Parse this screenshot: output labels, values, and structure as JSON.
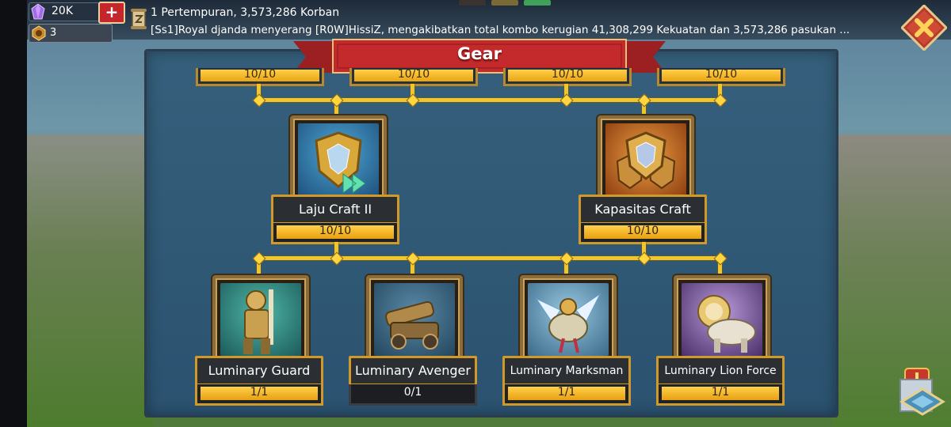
{
  "resources": {
    "gems": "20K",
    "tokens": "3"
  },
  "news": {
    "headline": "1 Pertempuran, 3,573,286 Korban",
    "detail": "[Ss1]Royal djanda menyerang [R0W]HissiZ, mengakibatkan total kombo kerugian 41,308,299 Kekuatan dan 3,573,286 pasukan ..."
  },
  "page_tabs": [
    {
      "color": "#3a3430"
    },
    {
      "color": "#7a6a35"
    },
    {
      "color": "#3fa15a"
    }
  ],
  "title": "Gear",
  "top_row": [
    {
      "progress": "10/10",
      "fill": 1.0
    },
    {
      "progress": "10/10",
      "fill": 1.0
    },
    {
      "progress": "10/10",
      "fill": 1.0
    },
    {
      "progress": "10/10",
      "fill": 1.0
    }
  ],
  "mid_row": [
    {
      "name": "Laju Craft II",
      "progress": "10/10",
      "fill": 1.0,
      "icon": "shield-speed-icon"
    },
    {
      "name": "Kapasitas Craft",
      "progress": "10/10",
      "fill": 1.0,
      "icon": "shield-capacity-icon"
    }
  ],
  "bottom_row": [
    {
      "name": "Luminary Guard",
      "progress": "1/1",
      "fill": 1.0,
      "icon": "knight-icon"
    },
    {
      "name": "Luminary Avenger",
      "progress": "0/1",
      "fill": 0.0,
      "icon": "siege-cannon-icon"
    },
    {
      "name": "Luminary Marksman",
      "progress": "1/1",
      "fill": 1.0,
      "icon": "griffin-rider-icon"
    },
    {
      "name": "Luminary Lion Force",
      "progress": "1/1",
      "fill": 1.0,
      "icon": "lion-icon"
    }
  ],
  "colors": {
    "accent_gold": "#f2c52a",
    "banner_red": "#c42a2c",
    "panel_blue": "#2f5874"
  }
}
